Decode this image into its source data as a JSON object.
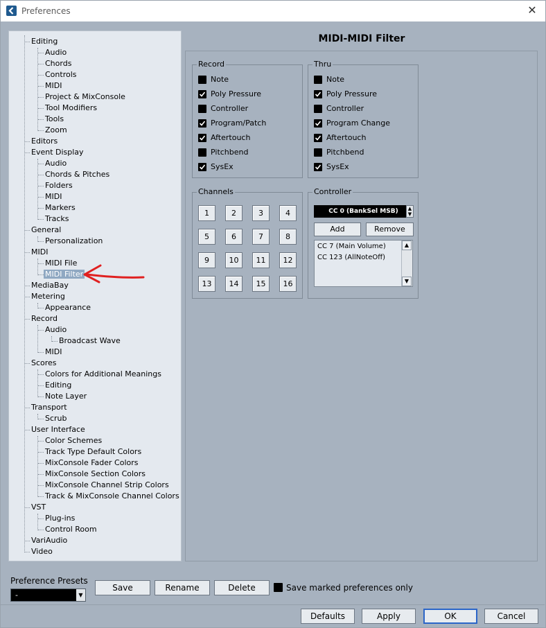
{
  "window": {
    "title": "Preferences",
    "close_glyph": "✕"
  },
  "tree": {
    "items": [
      {
        "label": "Editing"
      },
      {
        "label": "Audio"
      },
      {
        "label": "Chords"
      },
      {
        "label": "Controls"
      },
      {
        "label": "MIDI"
      },
      {
        "label": "Project & MixConsole"
      },
      {
        "label": "Tool Modifiers"
      },
      {
        "label": "Tools"
      },
      {
        "label": "Zoom"
      },
      {
        "label": "Editors"
      },
      {
        "label": "Event Display"
      },
      {
        "label": "Audio"
      },
      {
        "label": "Chords & Pitches"
      },
      {
        "label": "Folders"
      },
      {
        "label": "MIDI"
      },
      {
        "label": "Markers"
      },
      {
        "label": "Tracks"
      },
      {
        "label": "General"
      },
      {
        "label": "Personalization"
      },
      {
        "label": "MIDI"
      },
      {
        "label": "MIDI File"
      },
      {
        "label": "MIDI Filter"
      },
      {
        "label": "MediaBay"
      },
      {
        "label": "Metering"
      },
      {
        "label": "Appearance"
      },
      {
        "label": "Record"
      },
      {
        "label": "Audio"
      },
      {
        "label": "Broadcast Wave"
      },
      {
        "label": "MIDI"
      },
      {
        "label": "Scores"
      },
      {
        "label": "Colors for Additional Meanings"
      },
      {
        "label": "Editing"
      },
      {
        "label": "Note Layer"
      },
      {
        "label": "Transport"
      },
      {
        "label": "Scrub"
      },
      {
        "label": "User Interface"
      },
      {
        "label": "Color Schemes"
      },
      {
        "label": "Track Type Default Colors"
      },
      {
        "label": "MixConsole Fader Colors"
      },
      {
        "label": "MixConsole Section Colors"
      },
      {
        "label": "MixConsole Channel Strip Colors"
      },
      {
        "label": "Track & MixConsole Channel Colors"
      },
      {
        "label": "VST"
      },
      {
        "label": "Plug-ins"
      },
      {
        "label": "Control Room"
      },
      {
        "label": "VariAudio"
      },
      {
        "label": "Video"
      }
    ],
    "selected": "MIDI Filter"
  },
  "panel": {
    "title": "MIDI-MIDI Filter",
    "record": {
      "legend": "Record",
      "items": [
        {
          "label": "Note",
          "checked": false
        },
        {
          "label": "Poly Pressure",
          "checked": true
        },
        {
          "label": "Controller",
          "checked": false
        },
        {
          "label": "Program/Patch",
          "checked": true
        },
        {
          "label": "Aftertouch",
          "checked": true
        },
        {
          "label": "Pitchbend",
          "checked": false
        },
        {
          "label": "SysEx",
          "checked": true
        }
      ]
    },
    "thru": {
      "legend": "Thru",
      "items": [
        {
          "label": "Note",
          "checked": false
        },
        {
          "label": "Poly Pressure",
          "checked": true
        },
        {
          "label": "Controller",
          "checked": false
        },
        {
          "label": "Program Change",
          "checked": true
        },
        {
          "label": "Aftertouch",
          "checked": true
        },
        {
          "label": "Pitchbend",
          "checked": false
        },
        {
          "label": "SysEx",
          "checked": true
        }
      ]
    },
    "channels": {
      "legend": "Channels",
      "buttons": [
        "1",
        "2",
        "3",
        "4",
        "5",
        "6",
        "7",
        "8",
        "9",
        "10",
        "11",
        "12",
        "13",
        "14",
        "15",
        "16"
      ]
    },
    "controller": {
      "legend": "Controller",
      "current": "CC 0  (BankSel MSB)",
      "add_label": "Add",
      "remove_label": "Remove",
      "list": [
        "CC 7  (Main Volume)",
        "CC 123  (AllNoteOff)"
      ]
    }
  },
  "bottom": {
    "presets_label": "Preference Presets",
    "preset_value": "-",
    "save_label": "Save",
    "rename_label": "Rename",
    "delete_label": "Delete",
    "save_marked_label": "Save marked preferences only",
    "defaults_label": "Defaults",
    "apply_label": "Apply",
    "ok_label": "OK",
    "cancel_label": "Cancel"
  },
  "colors": {
    "annotation_arrow": "#e02020",
    "default_button_border": "#2b65c8"
  }
}
